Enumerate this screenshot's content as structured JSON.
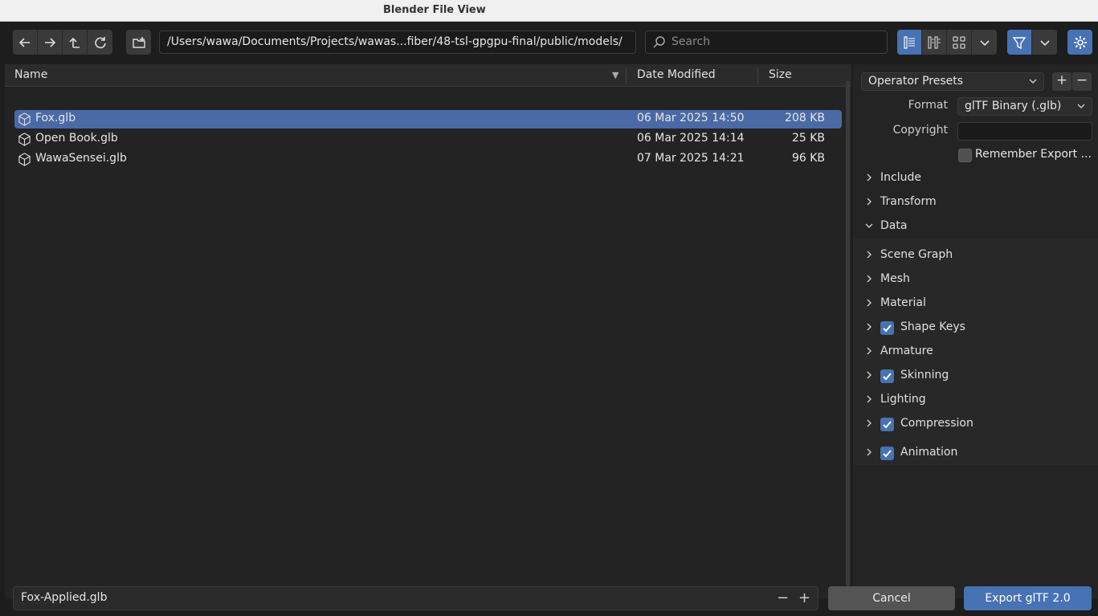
{
  "window": {
    "title": "Blender File View"
  },
  "toolbar": {
    "path": "/Users/wawa/Documents/Projects/wawas...fiber/48-tsl-gpgpu-final/public/models/",
    "search_placeholder": "Search"
  },
  "filelist": {
    "columns": {
      "name": "Name",
      "date": "Date Modified",
      "size": "Size"
    },
    "rows": [
      {
        "name": "Fox.glb",
        "date": "06 Mar 2025 14:50",
        "size": "208 KB",
        "selected": true
      },
      {
        "name": "Open Book.glb",
        "date": "06 Mar 2025 14:14",
        "size": "25 KB",
        "selected": false
      },
      {
        "name": "WawaSensei.glb",
        "date": "07 Mar 2025 14:21",
        "size": "96 KB",
        "selected": false
      }
    ]
  },
  "panel": {
    "presets_label": "Operator Presets",
    "format_label": "Format",
    "format_value": "glTF Binary (.glb)",
    "copyright_label": "Copyright",
    "remember_label": "Remember Export ...",
    "sections": {
      "include": "Include",
      "transform": "Transform",
      "data": "Data",
      "scene_graph": "Scene Graph",
      "mesh": "Mesh",
      "material": "Material",
      "shape_keys": "Shape Keys",
      "armature": "Armature",
      "skinning": "Skinning",
      "lighting": "Lighting",
      "compression": "Compression",
      "animation": "Animation"
    }
  },
  "footer": {
    "filename": "Fox-Applied.glb",
    "cancel_label": "Cancel",
    "export_label": "Export glTF 2.0"
  },
  "colors": {
    "accent": "#4772b3",
    "selected_row": "#4a6aa5"
  }
}
